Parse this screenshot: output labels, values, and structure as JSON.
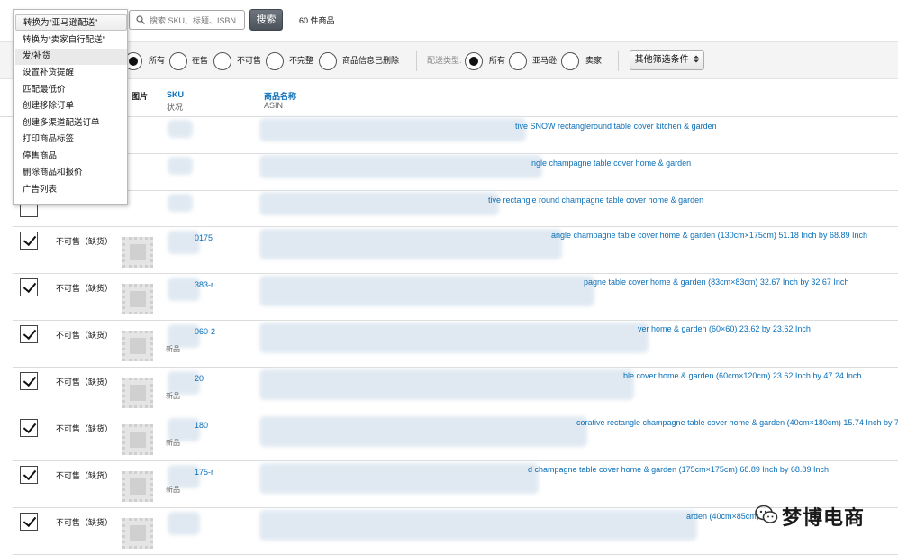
{
  "menu": {
    "items": [
      "转换为“亚马逊配送”",
      "转换为“卖家自行配送”",
      "发/补货",
      "设置补货提醒",
      "匹配最低价",
      "创建移除订单",
      "创建多渠道配送订单",
      "打印商品标签",
      "停售商品",
      "删除商品和报价",
      "广告列表"
    ]
  },
  "search": {
    "placeholder": "搜索 SKU、标题、ISBN",
    "button": "搜索",
    "result_count": "60 件商品"
  },
  "filters": {
    "status_options": [
      "所有",
      "在售",
      "不可售",
      "不完整",
      "商品信息已删除"
    ],
    "fulfillment_label": "配送类型:",
    "fulfillment_options": [
      "所有",
      "亚马逊",
      "卖家"
    ],
    "more_filters": "其他筛选条件",
    "more_icon": "updown-arrow-icon"
  },
  "table": {
    "headers": {
      "image": "图片",
      "sku": "SKU",
      "status": "状况",
      "name": "商品名称",
      "asin": "ASIN"
    },
    "rows": [
      {
        "checked": false,
        "status": "",
        "sku": "",
        "sku_sub": "",
        "title": "tive SNOW rectangleround table cover kitchen & garden"
      },
      {
        "checked": false,
        "status": "",
        "sku": "",
        "sku_sub": "",
        "title": "ngle champagne table cover home & garden"
      },
      {
        "checked": false,
        "status": "",
        "sku": "",
        "sku_sub": "",
        "title": "tive rectangle round champagne table cover home & garden"
      },
      {
        "checked": true,
        "status": "不可售（缺货）",
        "sku": "0175",
        "sku_sub": "",
        "title": "angle champagne table cover home & garden (130cm×175cm) 51.18 Inch by 68.89 Inch"
      },
      {
        "checked": true,
        "status": "不可售（缺货）",
        "sku": "383-r",
        "sku_sub": "",
        "title": "pagne table cover home & garden (83cm×83cm) 32.67 Inch by 32.67 Inch"
      },
      {
        "checked": true,
        "status": "不可售（缺货）",
        "sku": "060-2",
        "sku_sub": "新品",
        "title": "ver home & garden (60×60) 23.62 by 23.62 Inch"
      },
      {
        "checked": true,
        "status": "不可售（缺货）",
        "sku": "20",
        "sku_sub": "新品",
        "title": "ble cover home & garden (60cm×120cm) 23.62 Inch by 47.24 Inch"
      },
      {
        "checked": true,
        "status": "不可售（缺货）",
        "sku": "180",
        "sku_sub": "新品",
        "title": "corative rectangle champagne table cover home & garden (40cm×180cm) 15.74 Inch by 70.86 Inch"
      },
      {
        "checked": true,
        "status": "不可售（缺货）",
        "sku": "175-r",
        "sku_sub": "新品",
        "title": "d champagne table cover home & garden (175cm×175cm) 68.89 Inch by 68.89 Inch"
      },
      {
        "checked": true,
        "status": "不可售（缺货）",
        "sku": "",
        "sku_sub": "",
        "title": "arden (40cm×85cm)"
      }
    ]
  },
  "watermark": {
    "text": "梦博电商"
  },
  "colors": {
    "link": "#0a6fb8",
    "button_dark": "#555c64"
  }
}
